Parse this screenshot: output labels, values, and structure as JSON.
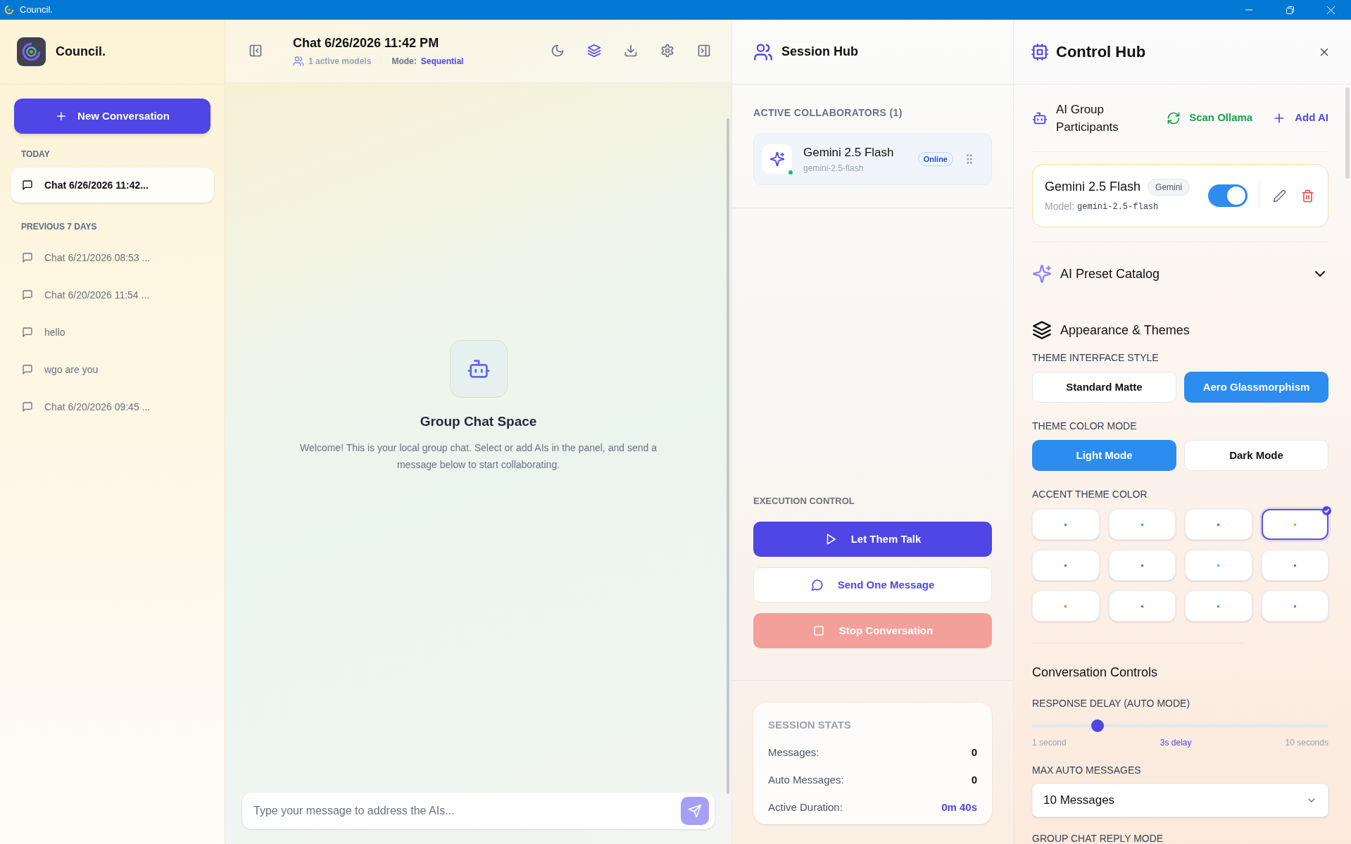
{
  "window": {
    "title": "Council."
  },
  "sidebar": {
    "app_name": "Council.",
    "new_button": "New Conversation",
    "groups": [
      {
        "label": "TODAY",
        "items": [
          {
            "title": "Chat 6/26/2026 11:42...",
            "selected": true
          }
        ]
      },
      {
        "label": "PREVIOUS 7 DAYS",
        "items": [
          {
            "title": "Chat 6/21/2026 08:53 ...",
            "selected": false
          },
          {
            "title": "Chat 6/20/2026 11:54 ...",
            "selected": false
          },
          {
            "title": "hello",
            "selected": false
          },
          {
            "title": "wgo are you",
            "selected": false
          },
          {
            "title": "Chat 6/20/2026 09:45 ...",
            "selected": false
          }
        ]
      }
    ]
  },
  "chat": {
    "title": "Chat 6/26/2026 11:42 PM",
    "active_models": "1 active models",
    "mode_label": "Mode:",
    "mode_value": "Sequential",
    "empty_title": "Group Chat Space",
    "empty_text": "Welcome! This is your local group chat. Select or add AIs in the panel, and send a message below to start collaborating.",
    "input_placeholder": "Type your message to address the AIs..."
  },
  "session_hub": {
    "title": "Session Hub",
    "collaborators_label": "ACTIVE COLLABORATORS (1)",
    "collaborators": [
      {
        "name": "Gemini 2.5 Flash",
        "model": "gemini-2.5-flash",
        "status": "Online",
        "online": true
      }
    ],
    "execution_label": "EXECUTION CONTROL",
    "buttons": [
      {
        "label": "Let Them Talk",
        "kind": "play"
      },
      {
        "label": "Send One Message",
        "kind": "send"
      },
      {
        "label": "Stop Conversation",
        "kind": "stop"
      }
    ],
    "stats_title": "SESSION STATS",
    "stats": [
      {
        "label": "Messages:",
        "value": "0",
        "highlight": false
      },
      {
        "label": "Auto Messages:",
        "value": "0",
        "highlight": false
      },
      {
        "label": "Active Duration:",
        "value": "0m 40s",
        "highlight": true
      }
    ]
  },
  "control_hub": {
    "title": "Control Hub",
    "participants_title": "AI Group Participants",
    "scan_button": "Scan Ollama",
    "add_button": "Add AI",
    "participants": [
      {
        "name": "Gemini 2.5 Flash",
        "provider": "Gemini",
        "model_label": "Model:",
        "model": "gemini-2.5-flash",
        "on": true
      }
    ],
    "preset_catalog": {
      "title": "AI Preset Catalog",
      "expanded": false
    },
    "appearance_title": "Appearance & Themes",
    "style_label": "THEME INTERFACE STYLE",
    "styles": [
      {
        "label": "Standard Matte",
        "selected": false
      },
      {
        "label": "Aero Glassmorphism",
        "selected": true
      }
    ],
    "mode_label": "THEME COLOR MODE",
    "modes": [
      {
        "label": "Light Mode",
        "selected": true
      },
      {
        "label": "Dark Mode",
        "selected": false
      }
    ],
    "accent_label": "ACCENT THEME COLOR",
    "accents": [
      {
        "color": "#3b82f6",
        "selected": false
      },
      {
        "color": "#10b981",
        "selected": false
      },
      {
        "color": "#ef4444",
        "selected": false
      },
      {
        "color": "#f59e0b",
        "selected": true
      },
      {
        "color": "#6366f1",
        "selected": false
      },
      {
        "color": "#64748b",
        "selected": false
      },
      {
        "color": "#34d399",
        "selected": false
      },
      {
        "color": "#d946a8",
        "selected": false
      },
      {
        "color": "#f97316",
        "selected": false
      },
      {
        "color": "#8b5cf6",
        "selected": false
      },
      {
        "color": "#14b8a6",
        "selected": false
      },
      {
        "color": "#ec4899",
        "selected": false
      }
    ],
    "conversation_title": "Conversation Controls",
    "delay_label": "RESPONSE DELAY (AUTO MODE)",
    "delay": {
      "level": 0.22,
      "min_label": "1 second",
      "value_label": "3s delay",
      "max_label": "10 seconds"
    },
    "max_label": "MAX AUTO MESSAGES",
    "max_value": "10 Messages",
    "reply_mode_label": "GROUP CHAT REPLY MODE"
  }
}
